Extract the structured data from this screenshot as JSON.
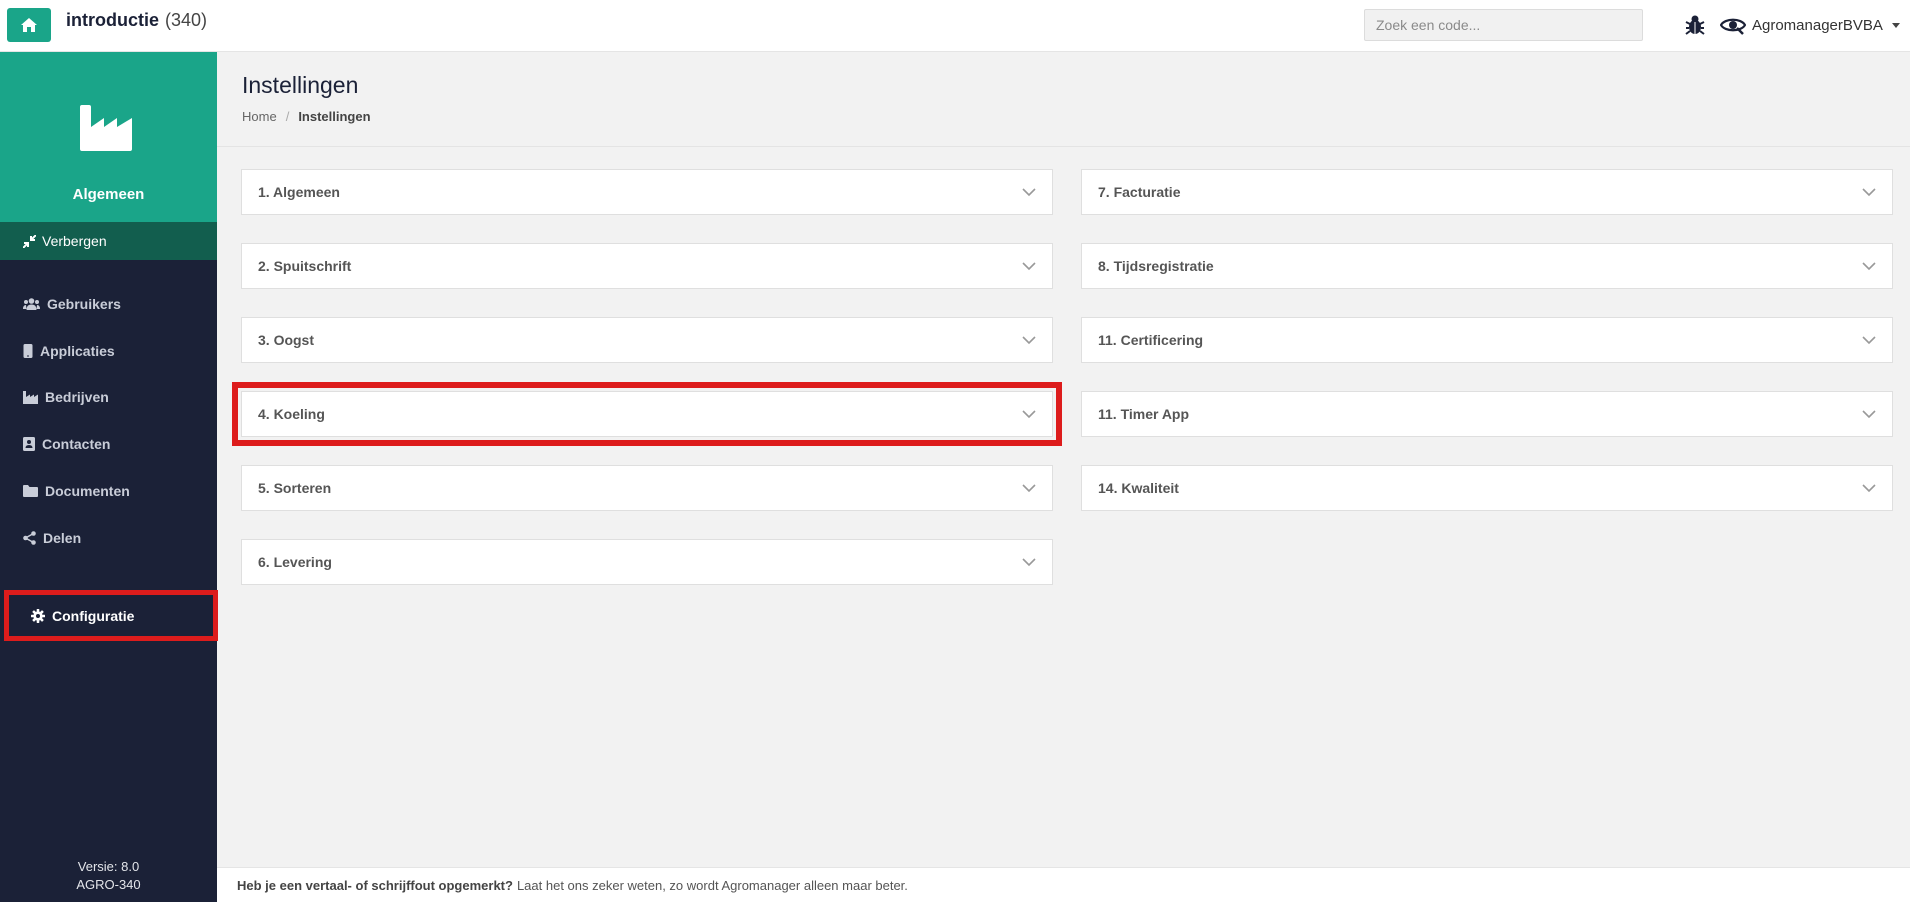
{
  "header": {
    "title": "introductie",
    "count": "(340)",
    "search_placeholder": "Zoek een code...",
    "user": "AgromanagerBVBA"
  },
  "sidebar": {
    "section_title": "Algemeen",
    "hide_label": "Verbergen",
    "items": [
      {
        "label": "Gebruikers",
        "icon": "users-icon"
      },
      {
        "label": "Applicaties",
        "icon": "mobile-icon"
      },
      {
        "label": "Bedrijven",
        "icon": "factory-icon"
      },
      {
        "label": "Contacten",
        "icon": "contact-card-icon"
      },
      {
        "label": "Documenten",
        "icon": "folder-icon"
      },
      {
        "label": "Delen",
        "icon": "share-icon"
      },
      {
        "label": "Configuratie",
        "icon": "gear-icon"
      }
    ],
    "version": "Versie: 8.0",
    "build": "AGRO-340"
  },
  "page": {
    "title": "Instellingen",
    "breadcrumb": [
      "Home",
      "Instellingen"
    ]
  },
  "panels": {
    "left": [
      "1. Algemeen",
      "2. Spuitschrift",
      "3. Oogst",
      "4. Koeling",
      "5. Sorteren",
      "6. Levering"
    ],
    "right": [
      "7. Facturatie",
      "8. Tijdsregistratie",
      "11. Certificering",
      "11. Timer App",
      "14. Kwaliteit"
    ]
  },
  "footer": {
    "question": "Heb je een vertaal- of schrijffout opgemerkt?",
    "text": "Laat het ons zeker weten, zo wordt Agromanager alleen maar beter."
  },
  "colors": {
    "brand": "#1aa589",
    "sidebar": "#1b2137",
    "highlight": "#dd1c1c"
  }
}
